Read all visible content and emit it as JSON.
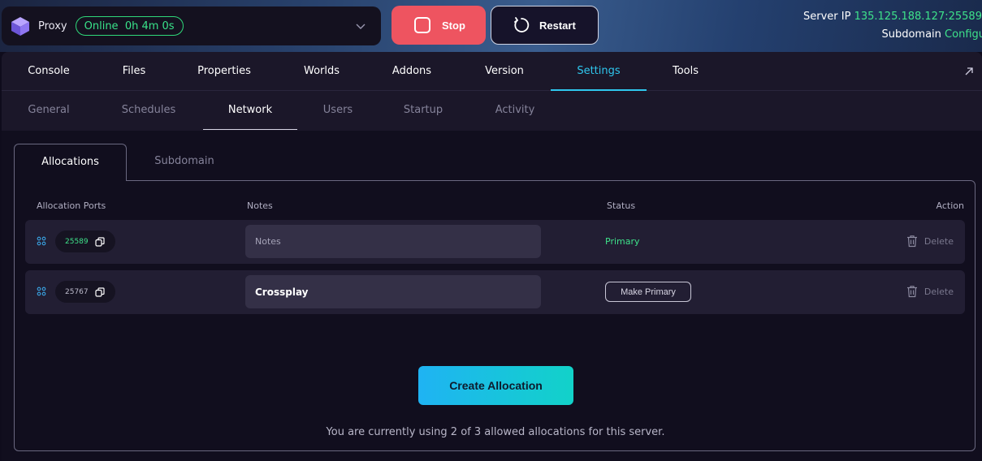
{
  "server": {
    "name": "Proxy",
    "status": "Online  0h 4m 0s",
    "ip_label": "Server IP",
    "ip_value": "135.125.188.127:25589",
    "subdomain_label": "Subdomain",
    "subdomain_value": "Configu"
  },
  "controls": {
    "stop_label": "Stop",
    "restart_label": "Restart"
  },
  "main_tabs": [
    "Console",
    "Files",
    "Properties",
    "Worlds",
    "Addons",
    "Version",
    "Settings",
    "Tools"
  ],
  "main_tab_active": "Settings",
  "sub_tabs": [
    "General",
    "Schedules",
    "Network",
    "Users",
    "Startup",
    "Activity"
  ],
  "sub_tab_active": "Network",
  "inner_tabs": [
    "Allocations",
    "Subdomain"
  ],
  "table": {
    "headers": [
      "Allocation Ports",
      "Notes",
      "Status",
      "Action"
    ],
    "rows": [
      {
        "port": "25589",
        "notes_placeholder": "Notes",
        "notes_value": "",
        "status": "Primary",
        "action": "Delete"
      },
      {
        "port": "25767",
        "notes_placeholder": "",
        "notes_value": "Crossplay",
        "status": "Make Primary",
        "action": "Delete"
      }
    ]
  },
  "create_label": "Create Allocation",
  "usage_text": "You are currently using 2 of 3 allowed allocations for this server.",
  "colors": {
    "accent": "#2fc7ee",
    "online": "#3ee28a",
    "stop": "#ee5460",
    "create_gradient_start": "#1fb3f3",
    "create_gradient_end": "#12d2c9"
  }
}
